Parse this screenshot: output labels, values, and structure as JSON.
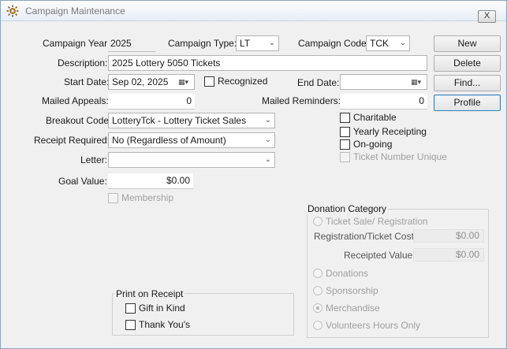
{
  "window": {
    "title": "Campaign Maintenance",
    "close_label": "X"
  },
  "form": {
    "campaign_year_label": "Campaign Year:",
    "campaign_year": "2025",
    "campaign_type_label": "Campaign Type:",
    "campaign_type": "LT",
    "campaign_code_label": "Campaign Code:",
    "campaign_code": "TCK",
    "description_label": "Description:",
    "description": "2025 Lottery 5050 Tickets",
    "start_date_label": "Start Date:",
    "start_date": "Sep 02, 2025",
    "recognized_label": "Recognized",
    "end_date_label": "End Date:",
    "end_date": "",
    "mailed_appeals_label": "Mailed Appeals:",
    "mailed_appeals": "0",
    "mailed_reminders_label": "Mailed Reminders:",
    "mailed_reminders": "0",
    "breakout_code_label": "Breakout Code:",
    "breakout_code": "LotteryTck - Lottery Ticket Sales",
    "receipt_required_label": "Receipt Required:",
    "receipt_required": "No (Regardless of Amount)",
    "letter_label": "Letter:",
    "letter": "",
    "goal_value_label": "Goal Value:",
    "goal_value": "$0.00",
    "membership_label": "Membership",
    "charitable_label": "Charitable",
    "yearly_receipting_label": "Yearly Receipting",
    "ongoing_label": "On-going",
    "ticket_number_unique_label": "Ticket Number Unique"
  },
  "buttons": {
    "new": "New",
    "delete": "Delete",
    "find": "Find...",
    "profile": "Profile"
  },
  "print_on_receipt": {
    "title": "Print on Receipt",
    "gift_in_kind": "Gift in Kind",
    "thank_yous": "Thank You's"
  },
  "donation_category": {
    "title": "Donation Category",
    "ticket_sale": "Ticket Sale/ Registration",
    "registration_cost_label": "Registration/Ticket Cost:",
    "registration_cost": "$0.00",
    "receipted_value_label": "Receipted Value:",
    "receipted_value": "$0.00",
    "donations": "Donations",
    "sponsorship": "Sponsorship",
    "merchandise": "Merchandise",
    "volunteers": "Volunteers Hours Only",
    "selected": "Merchandise"
  },
  "icons": {
    "app": "app-icon",
    "dropdown": "chevron-down-icon",
    "calendar": "calendar-icon"
  }
}
